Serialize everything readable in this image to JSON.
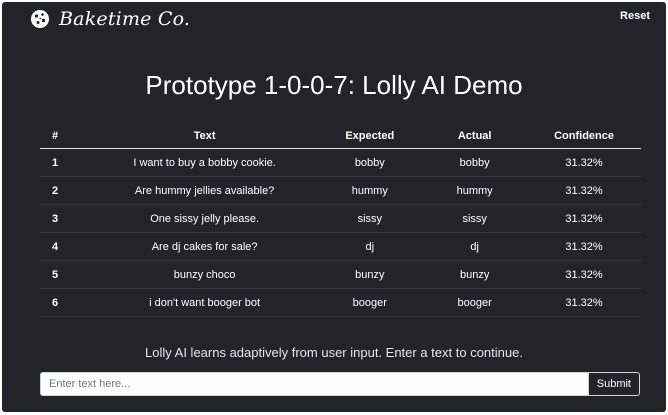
{
  "navbar": {
    "brand": "Baketime Co.",
    "reset_label": "Reset"
  },
  "main": {
    "title": "Prototype 1-0-0-7: Lolly AI Demo",
    "table": {
      "headers": [
        "#",
        "Text",
        "Expected",
        "Actual",
        "Confidence"
      ],
      "rows": [
        {
          "idx": "1",
          "text": "I want to buy a bobby cookie.",
          "expected": "bobby",
          "actual": "bobby",
          "confidence": "31.32%"
        },
        {
          "idx": "2",
          "text": "Are hummy jellies available?",
          "expected": "hummy",
          "actual": "hummy",
          "confidence": "31.32%"
        },
        {
          "idx": "3",
          "text": "One sissy jelly please.",
          "expected": "sissy",
          "actual": "sissy",
          "confidence": "31.32%"
        },
        {
          "idx": "4",
          "text": "Are dj cakes for sale?",
          "expected": "dj",
          "actual": "dj",
          "confidence": "31.32%"
        },
        {
          "idx": "5",
          "text": "bunzy choco",
          "expected": "bunzy",
          "actual": "bunzy",
          "confidence": "31.32%"
        },
        {
          "idx": "6",
          "text": "i don't want booger bot",
          "expected": "booger",
          "actual": "booger",
          "confidence": "31.32%"
        }
      ]
    },
    "info_text": "Lolly AI learns adaptively from user input. Enter a text to continue.",
    "input": {
      "value": "",
      "placeholder": "Enter text here..."
    },
    "submit_label": "Submit"
  },
  "colors": {
    "background": "#212529",
    "text": "#ffffff",
    "input_bg": "#ffffff"
  }
}
